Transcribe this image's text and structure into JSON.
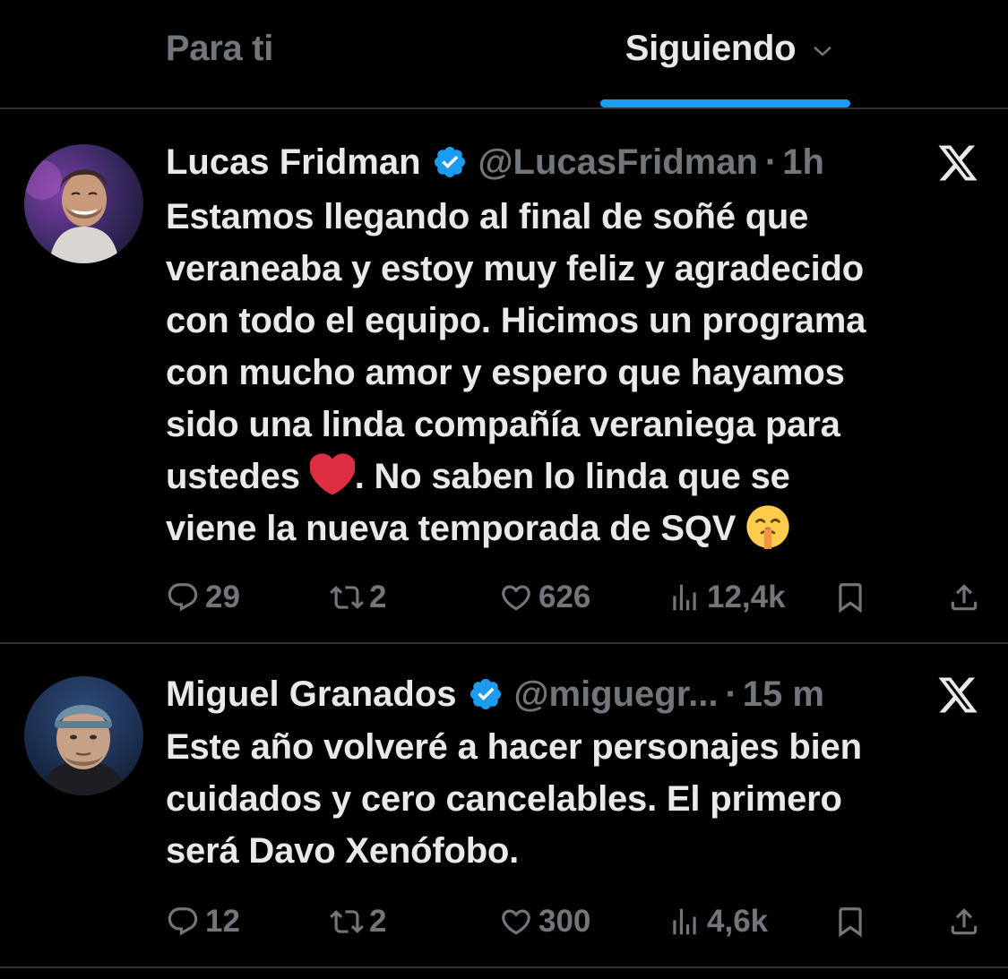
{
  "tabs": [
    {
      "label": "Para ti",
      "active": false
    },
    {
      "label": "Siguiendo",
      "active": true
    }
  ],
  "colors": {
    "background": "#000000",
    "text": "#e7e9ea",
    "muted": "#71767b",
    "accent": "#1d9bf0",
    "divider": "#2f3336"
  },
  "tweets": [
    {
      "name": "Lucas Fridman",
      "verified": true,
      "handle": "@LucasFridman",
      "separator": "·",
      "time": "1h",
      "text_lines": [
        "Estamos llegando al final de soñé que",
        "veraneaba y estoy muy feliz y agradecido",
        "con todo el equipo. Hicimos un programa",
        "con mucho amor y espero que hayamos",
        "sido una linda compañía veraniega para"
      ],
      "line6_before": "ustedes ",
      "line6_emoji": "❤️",
      "line6_after": ". No saben lo linda que se",
      "line7_text": "viene la nueva temporada de SQV ",
      "line7_emoji": "🤫",
      "stats": {
        "replies": "29",
        "retweets": "2",
        "likes": "626",
        "views": "12,4k"
      }
    },
    {
      "name": "Miguel Granados",
      "verified": true,
      "handle": "@miguegr...",
      "separator": "·",
      "time": "15 m",
      "text_lines": [
        "Este año volveré a hacer personajes bien",
        "cuidados y cero cancelables. El primero",
        "será Davo Xenófobo."
      ],
      "stats": {
        "replies": "12",
        "retweets": "2",
        "likes": "300",
        "views": "4,6k"
      }
    }
  ],
  "icons": {
    "verified": "verified-badge-icon",
    "platform": "x-logo-icon",
    "reply": "reply-icon",
    "retweet": "retweet-icon",
    "like": "heart-icon",
    "views": "views-icon",
    "bookmark": "bookmark-icon",
    "share": "share-icon",
    "tab_menu": "chevron-down-icon"
  }
}
